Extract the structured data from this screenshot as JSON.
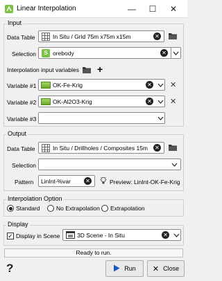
{
  "window": {
    "title": "Linear Interpolation",
    "minimize_glyph": "—",
    "maximize_glyph": "☐",
    "close_glyph": "✕"
  },
  "input": {
    "group_label": "Input",
    "data_table_label": "Data Table",
    "data_table_value": "In Situ / Grid 75m x75m x15m",
    "selection_label": "Selection",
    "selection_value": "orebody",
    "interp_vars_label": "Interpolation input variables",
    "variables": [
      {
        "label": "Variable #1",
        "value": "OK-Fe-Krig"
      },
      {
        "label": "Variable #2",
        "value": "OK-Al2O3-Krig"
      },
      {
        "label": "Variable #3",
        "value": ""
      }
    ]
  },
  "output": {
    "group_label": "Output",
    "data_table_label": "Data Table",
    "data_table_value": "In Situ / Drillholes / Composites 15m",
    "selection_label": "Selection",
    "selection_value": "",
    "pattern_label": "Pattern",
    "pattern_value": "LinInt-%var",
    "preview_text": "Preview: LinInt-OK-Fe-Krig"
  },
  "interpolation_option": {
    "group_label": "Interpolation Option",
    "options": [
      "Standard",
      "No Extrapolation",
      "Extrapolation"
    ],
    "selected": "Standard"
  },
  "display": {
    "group_label": "Display",
    "display_in_scene_label": "Display in Scene",
    "display_in_scene_checked": true,
    "scene_value": "3D Scene - In Situ"
  },
  "status_text": "Ready to run.",
  "buttons": {
    "help": "?",
    "run": "Run",
    "close": "Close"
  },
  "colors": {
    "accent_green": "#7cc242",
    "run_icon_blue": "#1a56c4"
  },
  "icons": [
    "app-icon",
    "folder-icon",
    "plus-icon",
    "grid-table-icon",
    "selection-icon",
    "variable-icon",
    "clear-icon",
    "chevron-down-icon",
    "remove-icon",
    "lightbulb-icon",
    "scene-icon",
    "run-icon",
    "close-x-icon",
    "help-icon"
  ]
}
